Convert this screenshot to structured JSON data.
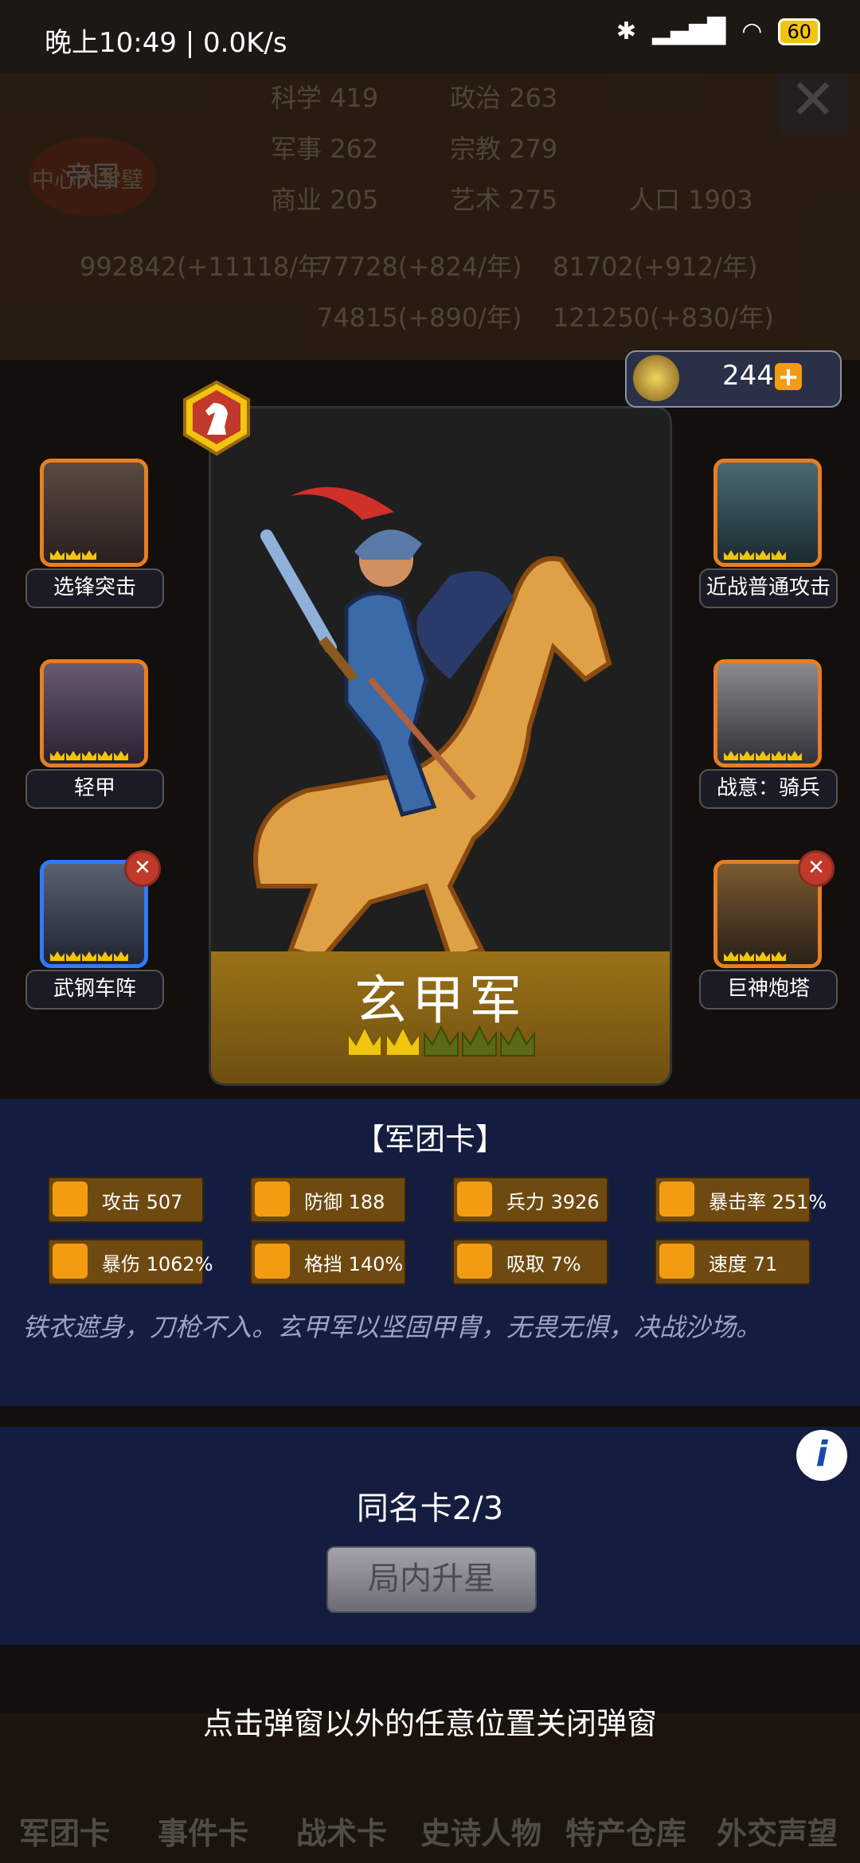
{
  "status_bar": {
    "time": "晚上10:49 | 0.0K/s",
    "battery": "60"
  },
  "background": {
    "emblem": "帝国",
    "building": "中心大学璧",
    "stats": [
      {
        "label": "科学",
        "value": "419"
      },
      {
        "label": "政治",
        "value": "263"
      },
      {
        "label": "军事",
        "value": "262"
      },
      {
        "label": "宗教",
        "value": "279"
      },
      {
        "label": "商业",
        "value": "205"
      },
      {
        "label": "艺术",
        "value": "275"
      },
      {
        "label": "人口",
        "value": "1903"
      }
    ],
    "resources": [
      "992842(+11118/年",
      "77728(+824/年)",
      "81702(+912/年)",
      "74815(+890/年)",
      "121250(+830/年)"
    ],
    "nav": [
      "军团卡",
      "事件卡",
      "战术卡",
      "史诗人物",
      "特产仓库",
      "外交声望"
    ]
  },
  "gold": {
    "amount": "244",
    "plus": "+"
  },
  "card": {
    "name": "玄甲军",
    "crowns_filled": 2,
    "crowns_total": 5,
    "accent": "#f1c40f"
  },
  "skills_left": [
    {
      "label": "选锋突击",
      "stars": 3,
      "frame": "orange"
    },
    {
      "label": "轻甲",
      "stars": 5,
      "frame": "orange"
    },
    {
      "label": "武钢车阵",
      "stars": 5,
      "frame": "blue",
      "removable": true
    }
  ],
  "skills_right": [
    {
      "label": "近战普通攻击",
      "stars": 4,
      "frame": "orange"
    },
    {
      "label": "战意：骑兵",
      "stars": 5,
      "frame": "orange"
    },
    {
      "label": "巨神炮塔",
      "stars": 4,
      "frame": "orange",
      "removable": true
    }
  ],
  "panel": {
    "title": "【军团卡】",
    "stats": [
      {
        "icon": "sword-icon",
        "text": "攻击 507"
      },
      {
        "icon": "shield-icon",
        "text": "防御 188"
      },
      {
        "icon": "heart-icon",
        "text": "兵力 3926"
      },
      {
        "icon": "crosshair-icon",
        "text": "暴击率 251%"
      },
      {
        "icon": "burst-icon",
        "text": "暴伤 1062%"
      },
      {
        "icon": "block-icon",
        "text": "格挡 140%"
      },
      {
        "icon": "drain-icon",
        "text": "吸取 7%"
      },
      {
        "icon": "speed-icon",
        "text": "速度 71"
      }
    ],
    "description": "铁衣遮身，刀枪不入。玄甲军以坚固甲胄，无畏无惧，决战沙场。"
  },
  "lower": {
    "duplicate": "同名卡2/3",
    "star_up_button": "局内升星",
    "info": "i"
  },
  "hint": "点击弹窗以外的任意位置关闭弹窗"
}
